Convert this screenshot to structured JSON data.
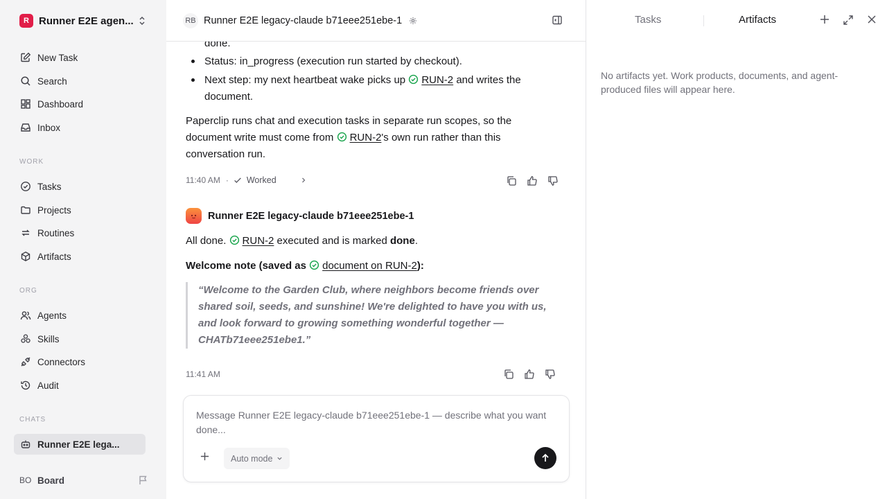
{
  "workspace": {
    "logo": "R",
    "name": "Runner E2E agen..."
  },
  "nav": {
    "new_task": "New Task",
    "search": "Search",
    "dashboard": "Dashboard",
    "inbox": "Inbox"
  },
  "sections": {
    "work": "WORK",
    "org": "ORG",
    "chats": "CHATS"
  },
  "work_items": {
    "tasks": "Tasks",
    "projects": "Projects",
    "routines": "Routines",
    "artifacts": "Artifacts"
  },
  "org_items": {
    "agents": "Agents",
    "skills": "Skills",
    "connectors": "Connectors",
    "audit": "Audit"
  },
  "chats": {
    "active": "Runner E2E lega..."
  },
  "board": {
    "initials": "BO",
    "label": "Board"
  },
  "header": {
    "initials": "RB",
    "title": "Runner E2E legacy-claude b71eee251ebe-1"
  },
  "msg1": {
    "partial": "done.",
    "status": "Status: in_progress (execution run started by checkout).",
    "next_pre": "Next step: my next heartbeat wake picks up ",
    "next_link": "RUN-2",
    "next_post": " and writes the",
    "next_cont": "document.",
    "para_a": "Paperclip runs chat and execution tasks in separate run scopes, so the",
    "para_b_pre": "document write must come from ",
    "para_b_link": "RUN-2",
    "para_b_post": "'s own run rather than this",
    "para_c": "conversation run.",
    "time": "11:40 AM",
    "sep": "·",
    "worked": "Worked"
  },
  "msg2": {
    "agent": "Runner E2E legacy-claude b71eee251ebe-1",
    "line1_pre": "All done. ",
    "line1_link": "RUN-2",
    "line1_mid": " executed and is marked ",
    "line1_bold": "done",
    "line1_end": ".",
    "welcome_pre": "Welcome note (saved as ",
    "welcome_link": "document on RUN-2",
    "welcome_end": "):",
    "quote_lines": [
      "“Welcome to the Garden Club, where neighbors become friends over",
      "shared soil, seeds, and sunshine! We're delighted to have you with us,",
      "and look forward to growing something wonderful together —",
      "CHATb71eee251ebe1.”"
    ],
    "time": "11:41 AM"
  },
  "composer": {
    "placeholder": "Message Runner E2E legacy-claude b71eee251ebe-1 — describe what you want done...",
    "mode": "Auto mode"
  },
  "right_panel": {
    "tab_tasks": "Tasks",
    "tab_artifacts": "Artifacts",
    "empty": "No artifacts yet. Work products, documents, and agent-produced files will appear here."
  },
  "colors": {
    "accent_check": "#16a34a",
    "brand": "#e11d48",
    "send": "#18181b"
  }
}
